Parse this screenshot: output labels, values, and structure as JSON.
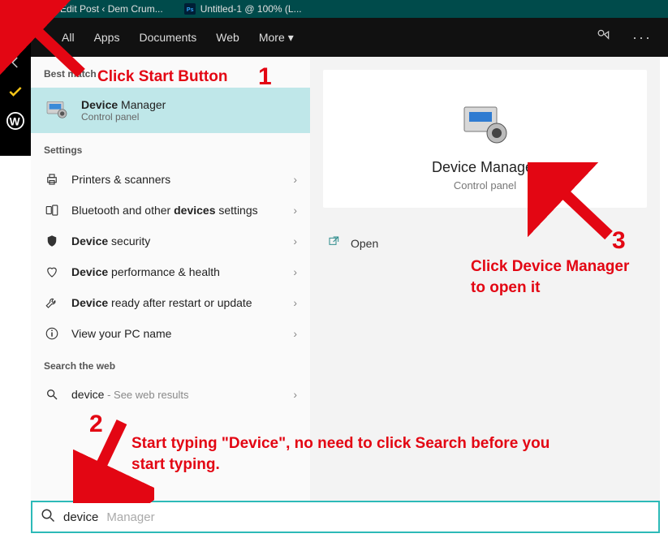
{
  "titlebar": {
    "tabs": [
      {
        "icon": "brave",
        "label": "Edit Post ‹ Dem Crum..."
      },
      {
        "icon": "ps",
        "label": "Untitled-1 @ 100% (L..."
      }
    ]
  },
  "osrail": {
    "items": [
      "outlook",
      "back",
      "check",
      "wp"
    ]
  },
  "tabbar": {
    "tabs": [
      "All",
      "Apps",
      "Documents",
      "Web",
      "More"
    ],
    "right_icons": [
      "feedback",
      "ellipsis"
    ]
  },
  "left": {
    "best_match_header": "Best match",
    "best_match": {
      "title_bold": "Device",
      "title_rest": " Manager",
      "subtitle": "Control panel"
    },
    "settings_header": "Settings",
    "settings": [
      {
        "icon": "printer",
        "label_plain_pre": "Printers & scanners",
        "bold": "",
        "label_plain_post": ""
      },
      {
        "icon": "bluetooth",
        "label_plain_pre": "Bluetooth and other ",
        "bold": "devices",
        "label_plain_post": " settings"
      },
      {
        "icon": "shield",
        "label_plain_pre": "",
        "bold": "Device",
        "label_plain_post": " security"
      },
      {
        "icon": "heart",
        "label_plain_pre": "",
        "bold": "Device",
        "label_plain_post": " performance & health"
      },
      {
        "icon": "wrench",
        "label_plain_pre": "",
        "bold": "Device",
        "label_plain_post": " ready after restart or update"
      },
      {
        "icon": "info",
        "label_plain_pre": "View your PC name",
        "bold": "",
        "label_plain_post": ""
      }
    ],
    "web_header": "Search the web",
    "web": {
      "term": "device",
      "suffix": " - See web results"
    }
  },
  "right": {
    "title": "Device Manager",
    "subtitle": "Control panel",
    "open_label": "Open"
  },
  "search": {
    "typed": "device",
    "hint": " Manager"
  },
  "annotations": {
    "a1_text": "Click Start Button",
    "a1_num": "1",
    "a2_num": "2",
    "a2_text": "Start typing \"Device\", no need to click Search before you\nstart typing.",
    "a3_num": "3",
    "a3_text": "Click Device Manager\nto open it"
  },
  "colors": {
    "accent": "#2dbab8",
    "anno": "#e30613",
    "highlight": "#bfe7e9"
  }
}
